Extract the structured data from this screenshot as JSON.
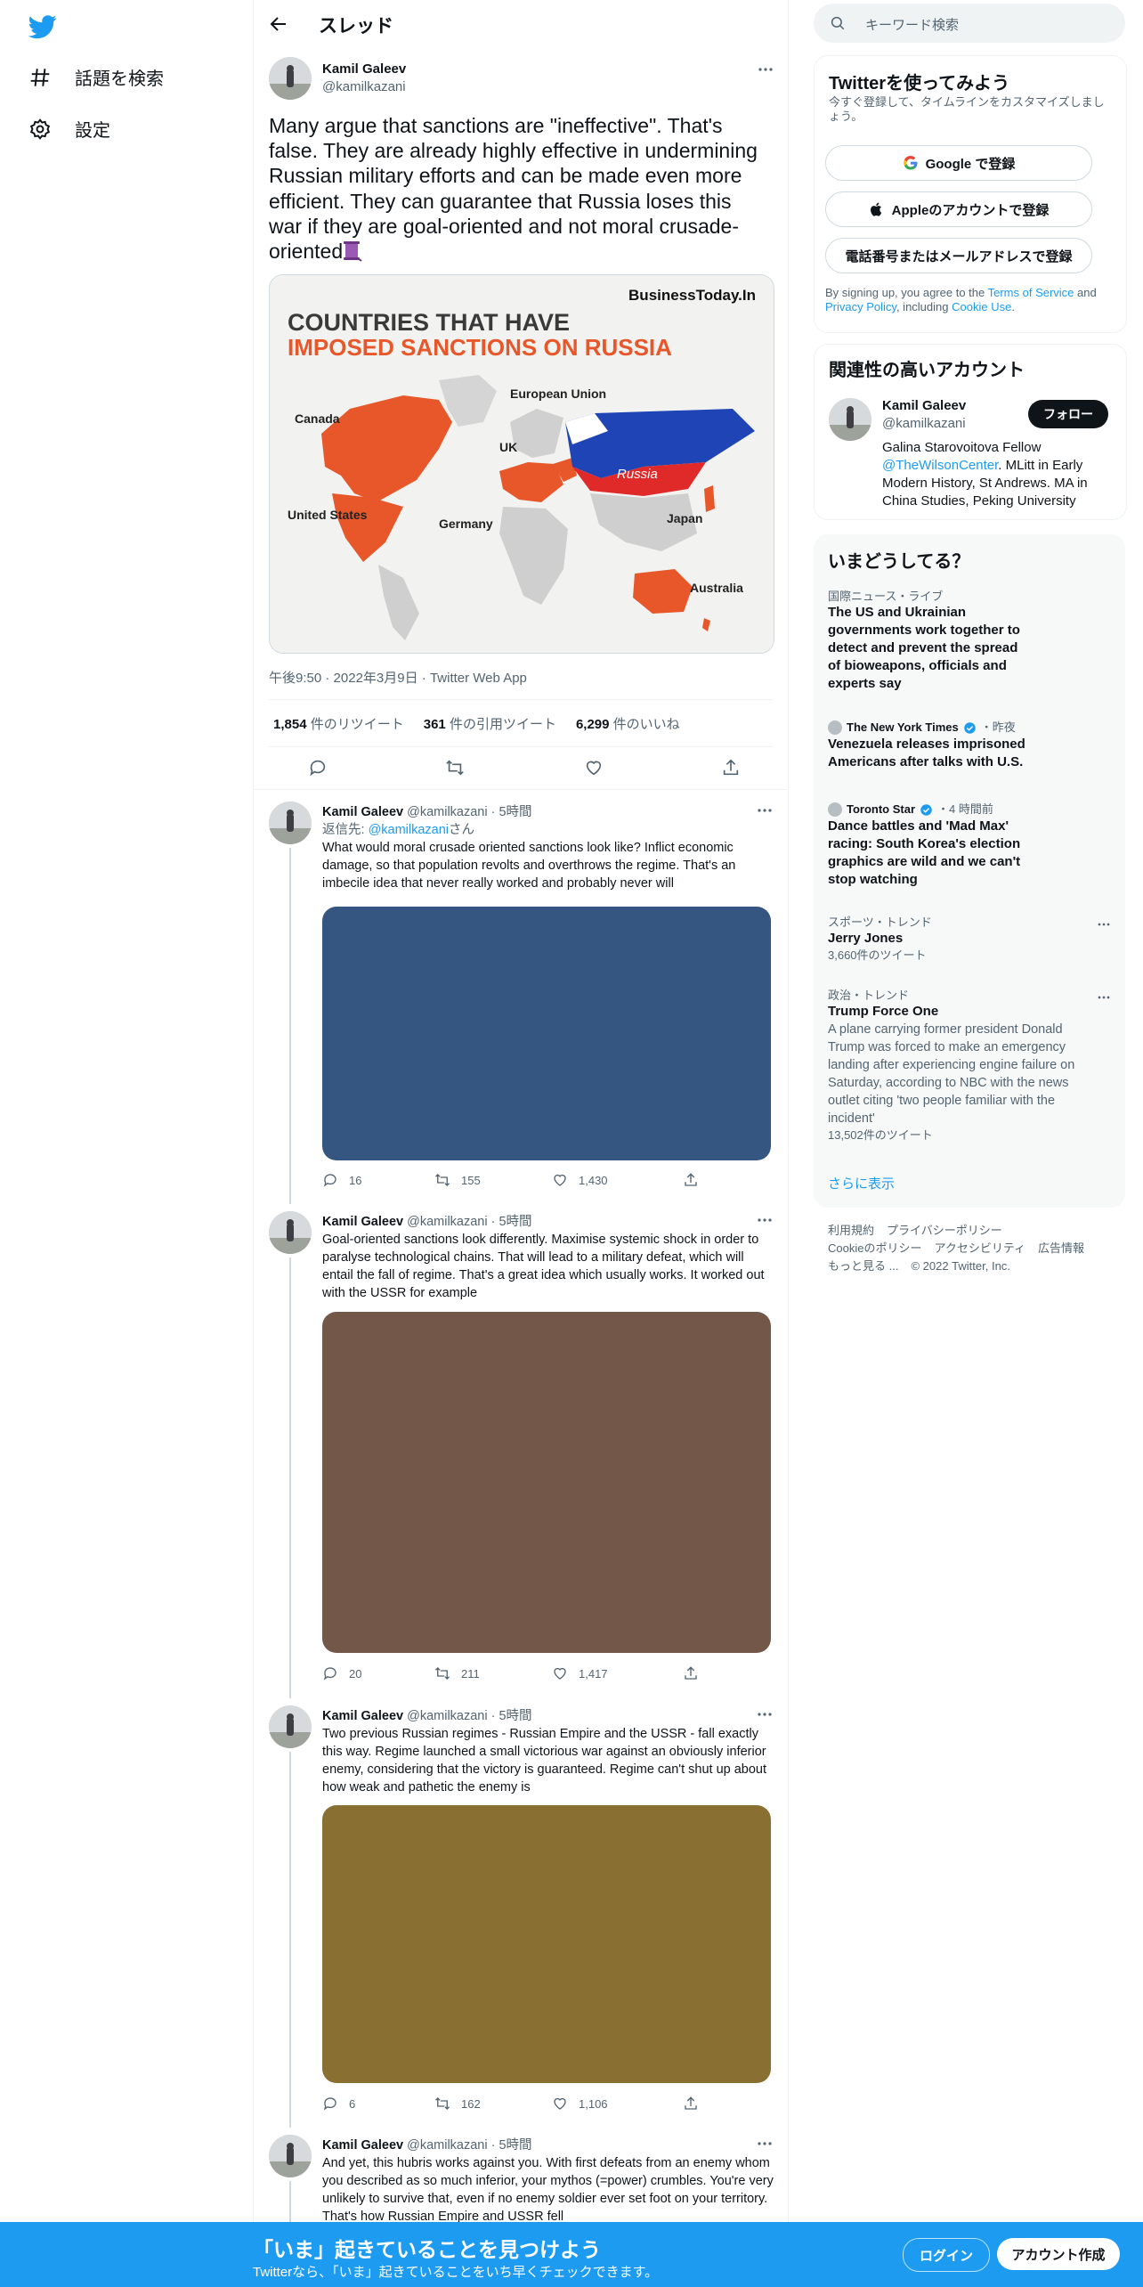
{
  "nav": {
    "explore_label": "話題を検索",
    "settings_label": "設定"
  },
  "header": {
    "title": "スレッド"
  },
  "focal": {
    "name": "Kamil Galeev",
    "handle": "@kamilkazani",
    "text": "Many argue that sanctions are \"ineffective\". That's false. They are already highly effective in undermining Russian military efforts and can be made even more efficient. They can guarantee that Russia loses this war if they are goal-oriented and not moral crusade-oriented",
    "image": {
      "source": "BusinessToday.In",
      "title_line1": "COUNTRIES THAT HAVE",
      "title_line2": "IMPOSED SANCTIONS ON RUSSIA",
      "labels": {
        "canada": "Canada",
        "us": "United States",
        "eu": "European Union",
        "uk": "UK",
        "germany": "Germany",
        "russia": "Russia",
        "japan": "Japan",
        "australia": "Australia"
      }
    },
    "time": "午後9:50",
    "date": "2022年3月9日",
    "via": "Twitter Web App",
    "retweets": "1,854",
    "retweets_label": "件のリツイート",
    "quotes": "361",
    "quotes_label": "件の引用ツイート",
    "likes": "6,299",
    "likes_label": "件のいいね"
  },
  "replies": [
    {
      "name": "Kamil Galeev",
      "handle": "@kamilkazani",
      "time": "5時間",
      "reply_prefix": "返信先: ",
      "reply_to": "@kamilkazani",
      "reply_suffix": "さん",
      "text": "What would moral crusade oriented sanctions look like? Inflict economic damage, so that population revolts and overthrows the regime. That's an imbecile idea that never really worked and probably never will",
      "media_color": "#355681",
      "replies": "16",
      "retweets": "155",
      "likes": "1,430"
    },
    {
      "name": "Kamil Galeev",
      "handle": "@kamilkazani",
      "time": "5時間",
      "text": "Goal-oriented sanctions look differently. Maximise systemic shock in order to paralyse technological chains. That will lead to a military defeat, which will entail the fall of regime. That's a great idea which usually works. It worked out with the USSR for example",
      "media_color": "#735748",
      "replies": "20",
      "retweets": "211",
      "likes": "1,417"
    },
    {
      "name": "Kamil Galeev",
      "handle": "@kamilkazani",
      "time": "5時間",
      "text": "Two previous Russian regimes - Russian Empire and the USSR - fall exactly this way. Regime launched a small victorious war against an obviously inferior enemy, considering that the victory is guaranteed. Regime can't shut up about how weak and pathetic the enemy is",
      "media_color": "#8a6f33",
      "replies": "6",
      "retweets": "162",
      "likes": "1,106"
    },
    {
      "name": "Kamil Galeev",
      "handle": "@kamilkazani",
      "time": "5時間",
      "text": "And yet, this hubris works against you. With first  defeats from an enemy whom you described as so much inferior, your mythos (=power) crumbles. You're very unlikely to survive that, even if no enemy soldier ever set foot on your territory. That's how Russian Empire and USSR fell"
    }
  ],
  "search": {
    "placeholder": "キーワード検索"
  },
  "signup": {
    "title": "Twitterを使ってみよう",
    "subtitle": "今すぐ登録して、タイムラインをカスタマイズしましょう。",
    "google": "Google で登録",
    "apple": "Appleのアカウントで登録",
    "phone": "電話番号またはメールアドレスで登録",
    "terms_1": "By signing up, you agree to the ",
    "terms_link1": "Terms of Service",
    "terms_2": " and ",
    "terms_link2": "Privacy Policy",
    "terms_3": ", including ",
    "terms_link3": "Cookie Use",
    "terms_4": "."
  },
  "related": {
    "title": "関連性の高いアカウント",
    "name": "Kamil Galeev",
    "handle": "@kamilkazani",
    "follow": "フォロー",
    "bio_1": "Galina Starovoitova Fellow ",
    "bio_link": "@TheWilsonCenter",
    "bio_2": ". MLitt in Early Modern History, St Andrews. MA in China Studies, Peking University"
  },
  "trends": {
    "title": "いまどうしてる？",
    "items": [
      {
        "category": "国際ニュース・ライブ",
        "title": "The US and Ukrainian governments work together to detect and prevent the spread of bioweapons, officials and experts say"
      },
      {
        "source": "The New York Times",
        "when": "・昨夜",
        "title": "Venezuela releases imprisoned Americans after talks with U.S."
      },
      {
        "source": "Toronto Star",
        "when": "・4 時間前",
        "title": "Dance battles and 'Mad Max' racing: South Korea's election graphics are wild and we can't stop watching"
      },
      {
        "category": "スポーツ・トレンド",
        "title": "Jerry Jones",
        "count": "3,660件のツイート"
      },
      {
        "category": "政治・トレンド",
        "title": "Trump Force One",
        "desc": "A plane carrying former president Donald Trump was forced to make an emergency landing after experiencing engine failure on Saturday, according to NBC with the news outlet citing 'two people familiar with the incident'",
        "count": "13,502件のツイート"
      }
    ],
    "show_more": "さらに表示"
  },
  "footer": {
    "terms": "利用規約",
    "privacy": "プライバシーポリシー",
    "cookie": "Cookieのポリシー",
    "access": "アクセシビリティ",
    "ads": "広告情報",
    "more": "もっと見る ...",
    "copyright": "© 2022 Twitter, Inc."
  },
  "banner": {
    "headline": "「いま」起きていることを見つけよう",
    "sub": "Twitterなら、「いま」起きていることをいち早くチェックできます。",
    "login": "ログイン",
    "signup": "アカウント作成"
  },
  "colors": {
    "accent": "#1d9bf0",
    "text": "#0f1419",
    "muted": "#536471"
  }
}
